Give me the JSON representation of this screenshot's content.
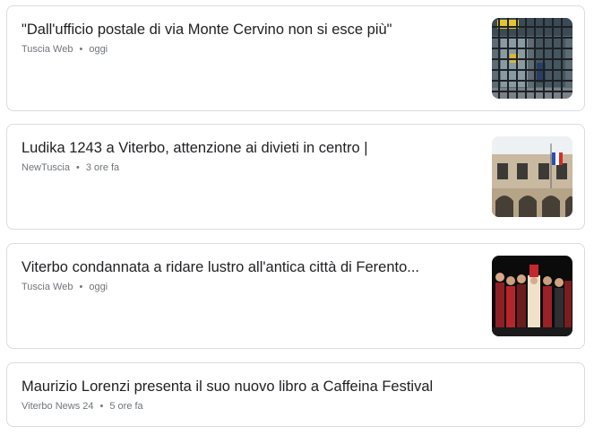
{
  "articles": [
    {
      "title": "\"Dall'ufficio postale di via Monte Cervino non si esce più\"",
      "source": "Tuscia Web",
      "separator": "•",
      "time": "oggi",
      "thumbnail": "post-office-grate-photo"
    },
    {
      "title": "Ludika 1243 a Viterbo, attenzione ai divieti in centro |",
      "source": "NewTuscia",
      "separator": "•",
      "time": "3 ore fa",
      "thumbnail": "palazzo-facade-photo"
    },
    {
      "title": "Viterbo condannata a ridare lustro all'antica città di Ferento...",
      "source": "Tuscia Web",
      "separator": "•",
      "time": "oggi",
      "thumbnail": "costumed-stage-photo"
    },
    {
      "title": "Maurizio Lorenzi presenta il suo nuovo libro a Caffeina Festival",
      "source": "Viterbo News 24",
      "separator": "•",
      "time": "5 ore fa"
    }
  ],
  "colors": {
    "title": "#202124",
    "meta": "#70757a",
    "border": "#dadce0"
  }
}
